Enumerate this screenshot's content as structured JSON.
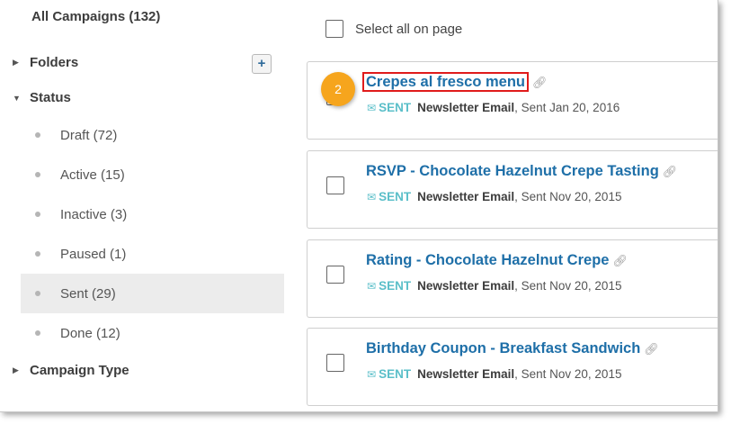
{
  "sidebar": {
    "all_campaigns": "All Campaigns (132)",
    "folders_label": "Folders",
    "add_folder_label": "+",
    "status_label": "Status",
    "status_items": [
      {
        "label": "Draft (72)"
      },
      {
        "label": "Active (15)"
      },
      {
        "label": "Inactive (3)"
      },
      {
        "label": "Paused (1)"
      },
      {
        "label": "Sent (29)",
        "selected": true
      },
      {
        "label": "Done (12)"
      }
    ],
    "campaign_type_label": "Campaign Type"
  },
  "main": {
    "select_all_label": "Select all on page",
    "campaigns": [
      {
        "title": "Crepes al fresco menu",
        "status": "SENT",
        "type": "Newsletter Email",
        "sent": ", Sent Jan 20, 2016"
      },
      {
        "title": "RSVP - Chocolate Hazelnut Crepe Tasting",
        "status": "SENT",
        "type": "Newsletter Email",
        "sent": ", Sent Nov 20, 2015"
      },
      {
        "title": "Rating - Chocolate Hazelnut Crepe",
        "status": "SENT",
        "type": "Newsletter Email",
        "sent": ", Sent Nov 20, 2015"
      },
      {
        "title": "Birthday Coupon - Breakfast Sandwich",
        "status": "SENT",
        "type": "Newsletter Email",
        "sent": ", Sent Nov 20, 2015"
      }
    ]
  },
  "annotation": {
    "step_number": "2",
    "badge_color": "#f6a51d",
    "highlight_color": "#e01b1b"
  },
  "colors": {
    "link": "#1e6fa8",
    "sent_badge": "#5bbfc9",
    "selected_row": "#ececec"
  },
  "icons": {
    "caret_collapsed": "caret-right-icon",
    "caret_expanded": "caret-down-icon",
    "link": "link-icon",
    "mail": "envelope-icon"
  }
}
